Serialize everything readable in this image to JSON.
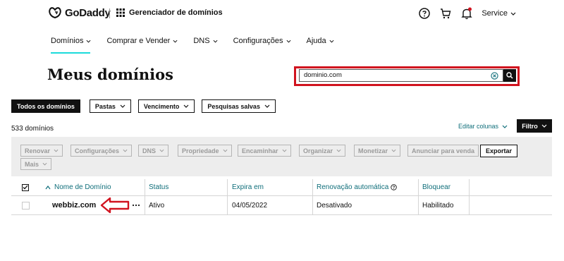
{
  "header": {
    "logo_text": "GoDaddy",
    "app_title": "Gerenciador de domínios",
    "account_label": "Service"
  },
  "nav": {
    "items": [
      {
        "label": "Domínios"
      },
      {
        "label": "Comprar e Vender"
      },
      {
        "label": "DNS"
      },
      {
        "label": "Configurações"
      },
      {
        "label": "Ajuda"
      }
    ],
    "active": "Domínios",
    "accent": "#1bdbdb"
  },
  "page": {
    "title": "Meus domínios"
  },
  "search": {
    "value": "dominio.com",
    "highlight_color": "#d1131f"
  },
  "filters": {
    "all_label": "Todos os domínios",
    "dropdowns": [
      "Pastas",
      "Vencimento",
      "Pesquisas salvas"
    ]
  },
  "summary": {
    "count_text": "533 domínios",
    "edit_columns": "Editar colunas",
    "filter_button": "Filtro"
  },
  "actions": {
    "disabled_buttons": [
      "Renovar",
      "Configurações",
      "DNS",
      "Propriedade",
      "Encaminhar",
      "Organizar",
      "Monetizar"
    ],
    "sell_button": "Anunciar para venda",
    "export_button": "Exportar",
    "more_button": "Mais"
  },
  "table": {
    "columns": [
      "Nome de Domínio",
      "Status",
      "Expira em",
      "Renovação automática",
      "Bloquear"
    ],
    "rows": [
      {
        "domain": "webbiz.com",
        "status": "Ativo",
        "expires": "04/05/2022",
        "auto_renew": "Desativado",
        "lock": "Habilitado"
      }
    ]
  },
  "annotation": {
    "arrow_color": "#d1131f"
  }
}
